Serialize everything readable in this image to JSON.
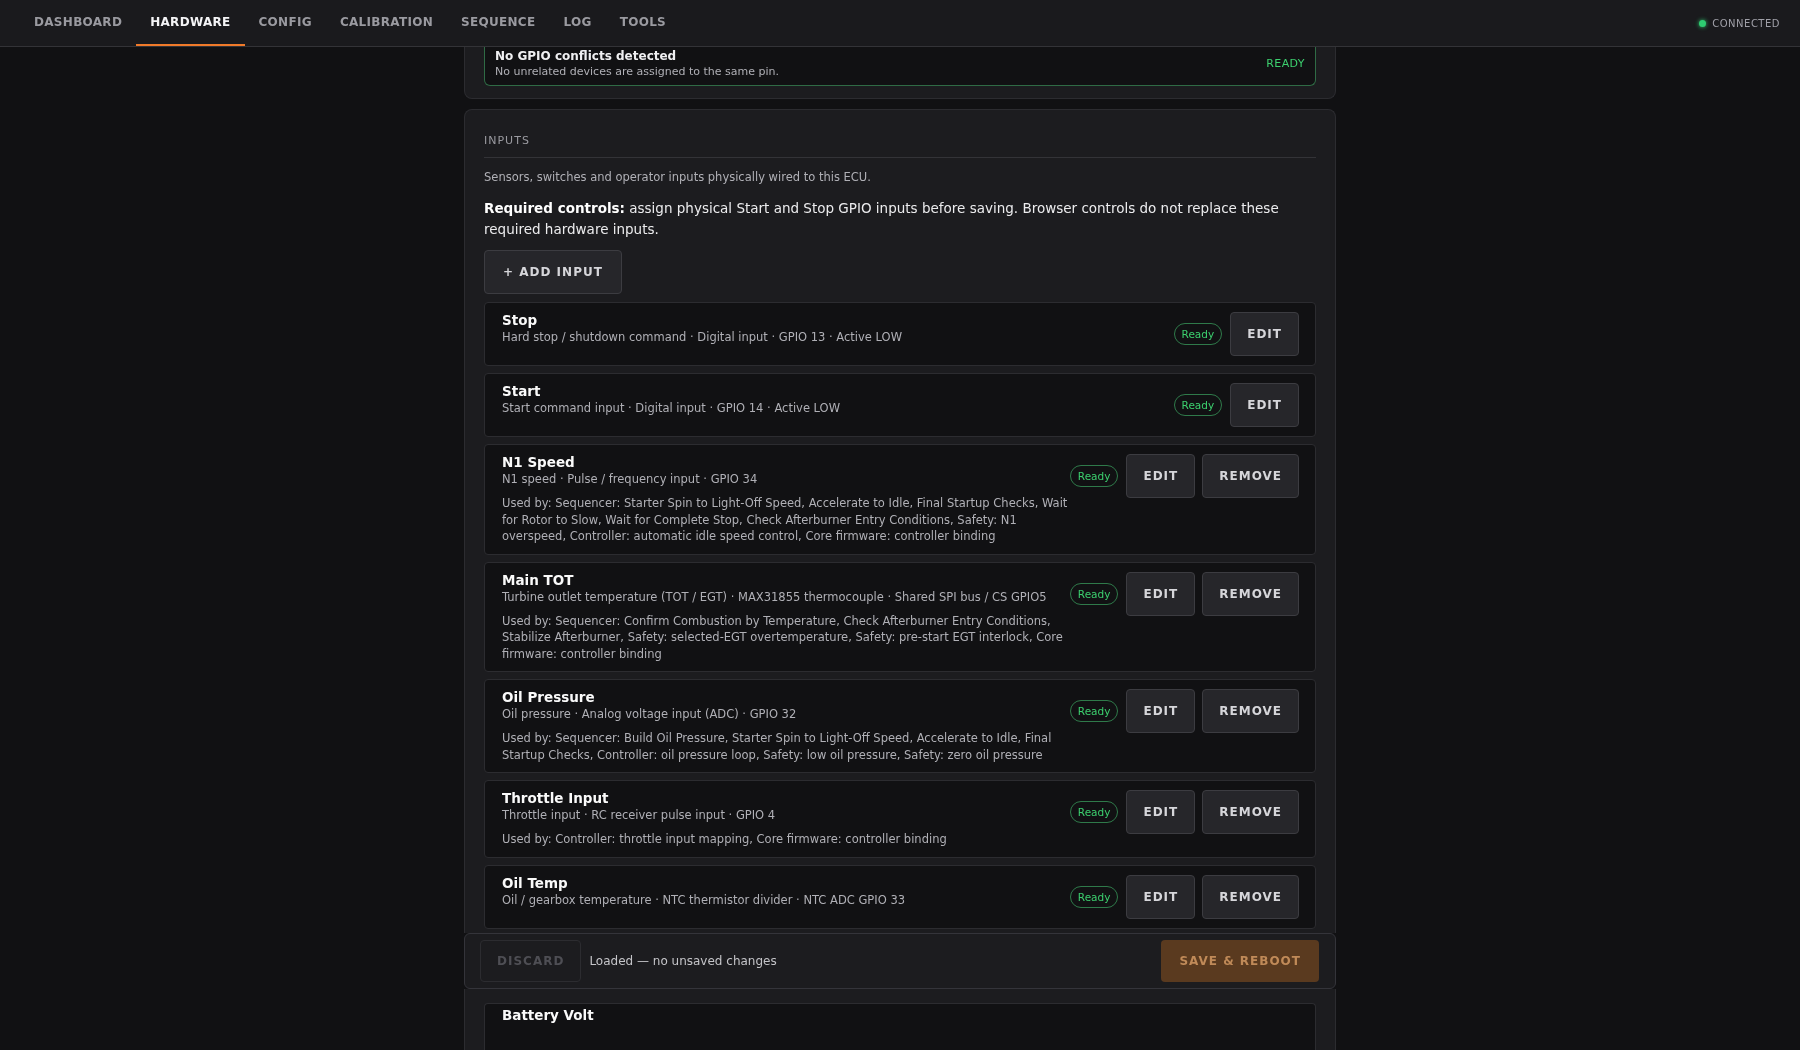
{
  "nav": {
    "tabs": [
      {
        "label": "DASHBOARD",
        "selected": false
      },
      {
        "label": "HARDWARE",
        "selected": true
      },
      {
        "label": "CONFIG",
        "selected": false
      },
      {
        "label": "CALIBRATION",
        "selected": false
      },
      {
        "label": "SEQUENCE",
        "selected": false
      },
      {
        "label": "LOG",
        "selected": false
      },
      {
        "label": "TOOLS",
        "selected": false
      }
    ],
    "connection": {
      "label": "CONNECTED",
      "connected": true
    }
  },
  "gpio_check": {
    "title": "No GPIO conflicts detected",
    "message": "No unrelated devices are assigned to the same pin.",
    "status": "READY"
  },
  "inputs": {
    "heading": "INPUTS",
    "description": "Sensors, switches and operator inputs physically wired to this ECU.",
    "notice": "**Required controls:** assign physical Start and Stop GPIO inputs before saving. Browser controls do not replace these required hardware inputs.",
    "add_button": "+ ADD INPUT",
    "items": [
      {
        "name": "Stop",
        "detail": "Hard stop / shutdown command · Digital input · GPIO 13 · Active LOW",
        "status": "Ready",
        "actions": [
          "EDIT"
        ]
      },
      {
        "name": "Start",
        "detail": "Start command input · Digital input · GPIO 14 · Active LOW",
        "status": "Ready",
        "actions": [
          "EDIT"
        ]
      },
      {
        "name": "N1 Speed",
        "detail": "N1 speed · Pulse / frequency input · GPIO 34",
        "used_by": "Used by: Sequencer: Starter Spin to Light-Off Speed, Accelerate to Idle, Final Startup Checks, Wait for Rotor to Slow, Wait for Complete Stop, Check Afterburner Entry Conditions, Safety: N1 overspeed, Controller: automatic idle speed control, Core firmware: controller binding",
        "status": "Ready",
        "actions": [
          "EDIT",
          "REMOVE"
        ]
      },
      {
        "name": "Main TOT",
        "detail": "Turbine outlet temperature (TOT / EGT) · MAX31855 thermocouple · Shared SPI bus / CS GPIO5",
        "used_by": "Used by: Sequencer: Confirm Combustion by Temperature, Check Afterburner Entry Conditions, Stabilize Afterburner, Safety: selected-EGT overtemperature, Safety: pre-start EGT interlock, Core firmware: controller binding",
        "status": "Ready",
        "actions": [
          "EDIT",
          "REMOVE"
        ]
      },
      {
        "name": "Oil Pressure",
        "detail": "Oil pressure · Analog voltage input (ADC) · GPIO 32",
        "used_by": "Used by: Sequencer: Build Oil Pressure, Starter Spin to Light-Off Speed, Accelerate to Idle, Final Startup Checks, Controller: oil pressure loop, Safety: low oil pressure, Safety: zero oil pressure",
        "status": "Ready",
        "actions": [
          "EDIT",
          "REMOVE"
        ]
      },
      {
        "name": "Throttle Input",
        "detail": "Throttle input · RC receiver pulse input · GPIO 4",
        "used_by": "Used by: Controller: throttle input mapping, Core firmware: controller binding",
        "status": "Ready",
        "actions": [
          "EDIT",
          "REMOVE"
        ]
      },
      {
        "name": "Oil Temp",
        "detail": "Oil / gearbox temperature · NTC thermistor divider · NTC ADC GPIO 33",
        "status": "Ready",
        "actions": [
          "EDIT",
          "REMOVE"
        ]
      },
      {
        "name": "Battery Volt"
      }
    ]
  },
  "footer": {
    "discard": {
      "label": "DISCARD",
      "disabled": true
    },
    "message": "Loaded — no unsaved changes",
    "save": {
      "label": "SAVE & REBOOT",
      "disabled": true
    }
  }
}
